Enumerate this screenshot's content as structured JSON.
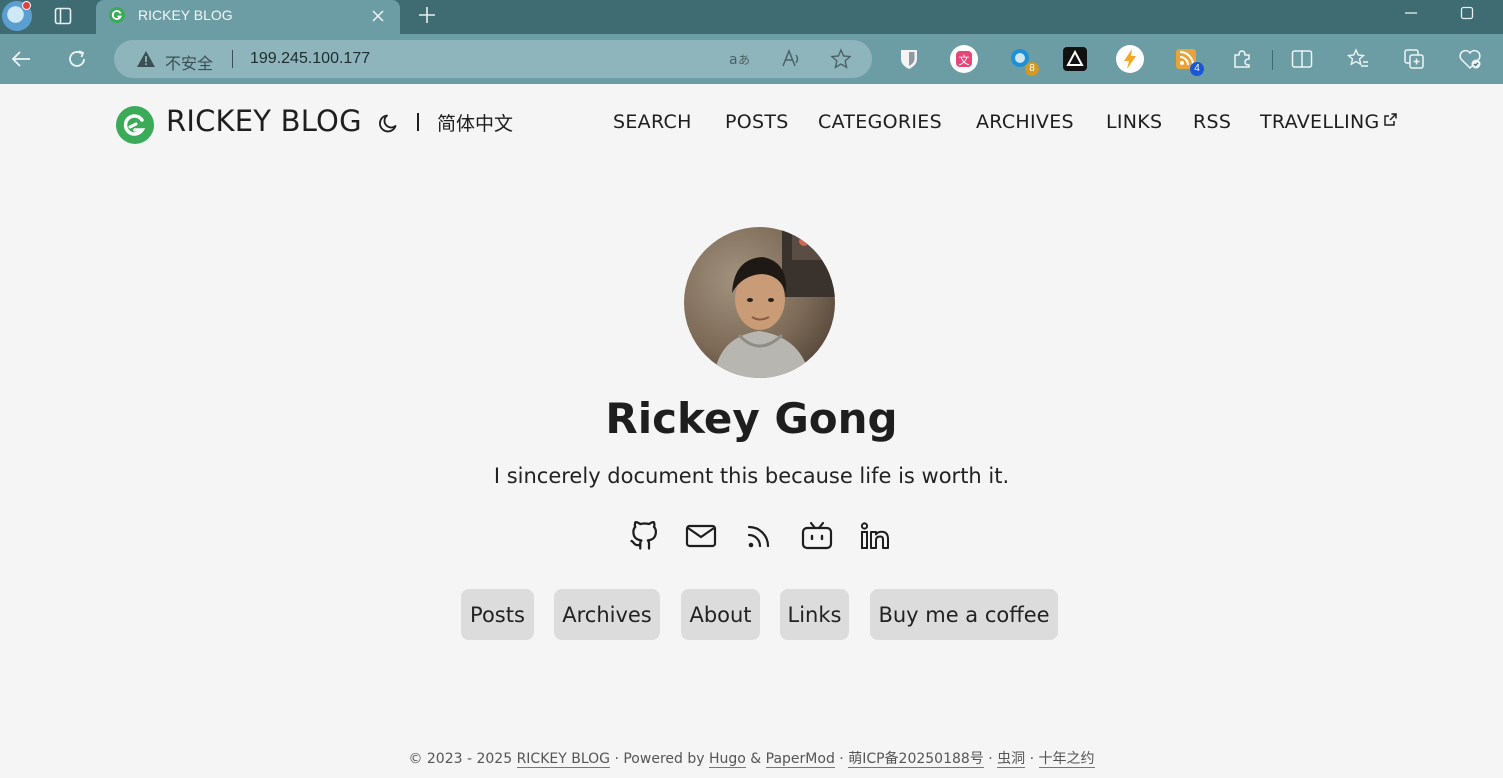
{
  "browser": {
    "tab_title": "RICKEY BLOG",
    "security_label": "不安全",
    "url": "199.245.100.177",
    "extensions": [
      {
        "name": "bitwarden"
      },
      {
        "name": "translate-extension"
      },
      {
        "name": "search-extension",
        "badge": "8"
      },
      {
        "name": "vercel-extension"
      },
      {
        "name": "speed-extension"
      },
      {
        "name": "rss-extension",
        "badge": "4"
      }
    ]
  },
  "site": {
    "name": "RICKEY BLOG",
    "language": "简体中文",
    "menu": [
      "SEARCH",
      "POSTS",
      "CATEGORIES",
      "ARCHIVES",
      "LINKS",
      "RSS",
      "TRAVELLING"
    ]
  },
  "profile": {
    "name": "Rickey Gong",
    "subtitle": "I sincerely document this because life is worth it.",
    "social_icons": [
      "github-icon",
      "mail-icon",
      "rss-icon",
      "bilibili-icon",
      "linkedin-icon"
    ],
    "buttons": [
      "Posts",
      "Archives",
      "About",
      "Links",
      "Buy me a coffee"
    ]
  },
  "footer": {
    "prefix": "© 2023 - 2025 ",
    "site_link": "RICKEY BLOG",
    "sep1": " · Powered by ",
    "hugo": "Hugo",
    "amp": " & ",
    "papermod": "PaperMod",
    "sep2": " · ",
    "icp": "萌ICP备20250188号",
    "sep3": " · ",
    "wormhole": "虫洞",
    "sep4": " · ",
    "ten_year": "十年之约"
  },
  "colors": {
    "chrome_dark": "#3f6b73",
    "chrome_light": "#6c9ca4",
    "page_bg": "#f5f5f5",
    "logo_green": "#3bab5a",
    "button_bg": "#dcdcdc"
  }
}
